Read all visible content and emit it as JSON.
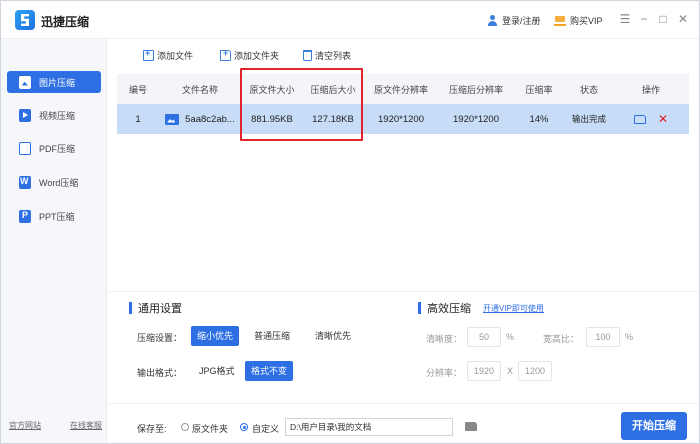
{
  "app": {
    "title": "迅捷压缩"
  },
  "titlebar": {
    "login": "登录/注册",
    "vip": "购买VIP"
  },
  "sidebar": {
    "items": [
      {
        "label": "图片压缩",
        "icon": "image-icon"
      },
      {
        "label": "视频压缩",
        "icon": "video-icon"
      },
      {
        "label": "PDF压缩",
        "icon": "pdf-icon"
      },
      {
        "label": "Word压缩",
        "icon": "word-icon"
      },
      {
        "label": "PPT压缩",
        "icon": "ppt-icon"
      }
    ],
    "official_site": "官方网站",
    "online_support": "在线客服"
  },
  "toolbar": {
    "add_file": "添加文件",
    "add_folder": "添加文件夹",
    "clear_list": "清空列表"
  },
  "table": {
    "headers": [
      "编号",
      "文件名称",
      "原文件大小",
      "压缩后大小",
      "原文件分辨率",
      "压缩后分辨率",
      "压缩率",
      "状态",
      "操作"
    ],
    "rows": [
      {
        "index": "1",
        "name": "5aa8c2ab...",
        "orig_size": "881.95KB",
        "comp_size": "127.18KB",
        "orig_res": "1920*1200",
        "comp_res": "1920*1200",
        "ratio": "14%",
        "status": "输出完成"
      }
    ]
  },
  "settings": {
    "general_title": "通用设置",
    "level_label": "压缩设置：",
    "level_options": [
      "缩小优先",
      "普通压缩",
      "清晰优先"
    ],
    "format_label": "输出格式：",
    "format_options": [
      "JPG格式",
      "格式不变"
    ],
    "advanced_title": "高效压缩",
    "vip_link": "开通VIP即可使用",
    "clarity_label": "清晰度：",
    "clarity_value": "50",
    "clarity_unit": "%",
    "aspect_label": "宽高比：",
    "aspect_value": "100",
    "aspect_unit": "%",
    "resolution_label": "分辨率：",
    "res_width": "1920",
    "res_sep": "X",
    "res_height": "1200"
  },
  "footer": {
    "save_to": "保存至:",
    "radio_original": "原文件夹",
    "radio_custom": "自定义",
    "path": "D:\\用户目录\\我的文档",
    "start": "开始压缩"
  },
  "colors": {
    "accent": "#2f6fe4",
    "row_selected": "#c7ddf7",
    "highlight": "#e0242b"
  }
}
